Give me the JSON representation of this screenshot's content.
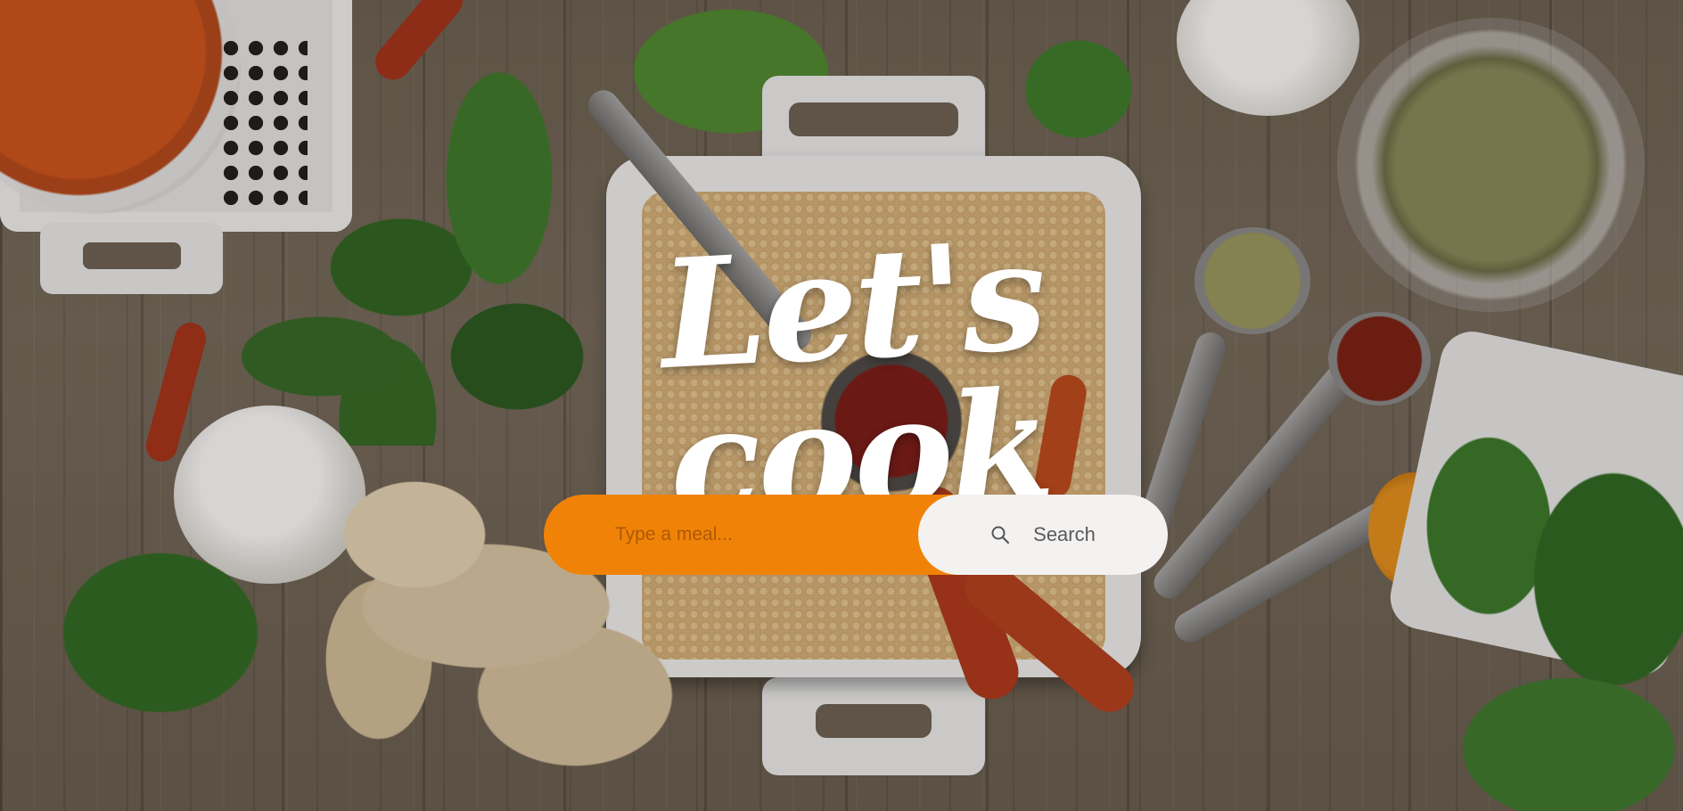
{
  "hero": {
    "title": "Let's cook",
    "background_description_icon": "spices-herbs-background"
  },
  "search": {
    "placeholder": "Type a meal...",
    "value": "",
    "button_label": "Search",
    "button_icon": "search-icon"
  },
  "colors": {
    "accent": "#f08307",
    "button_bg": "#f3f2f1",
    "title_color": "#ffffff"
  }
}
